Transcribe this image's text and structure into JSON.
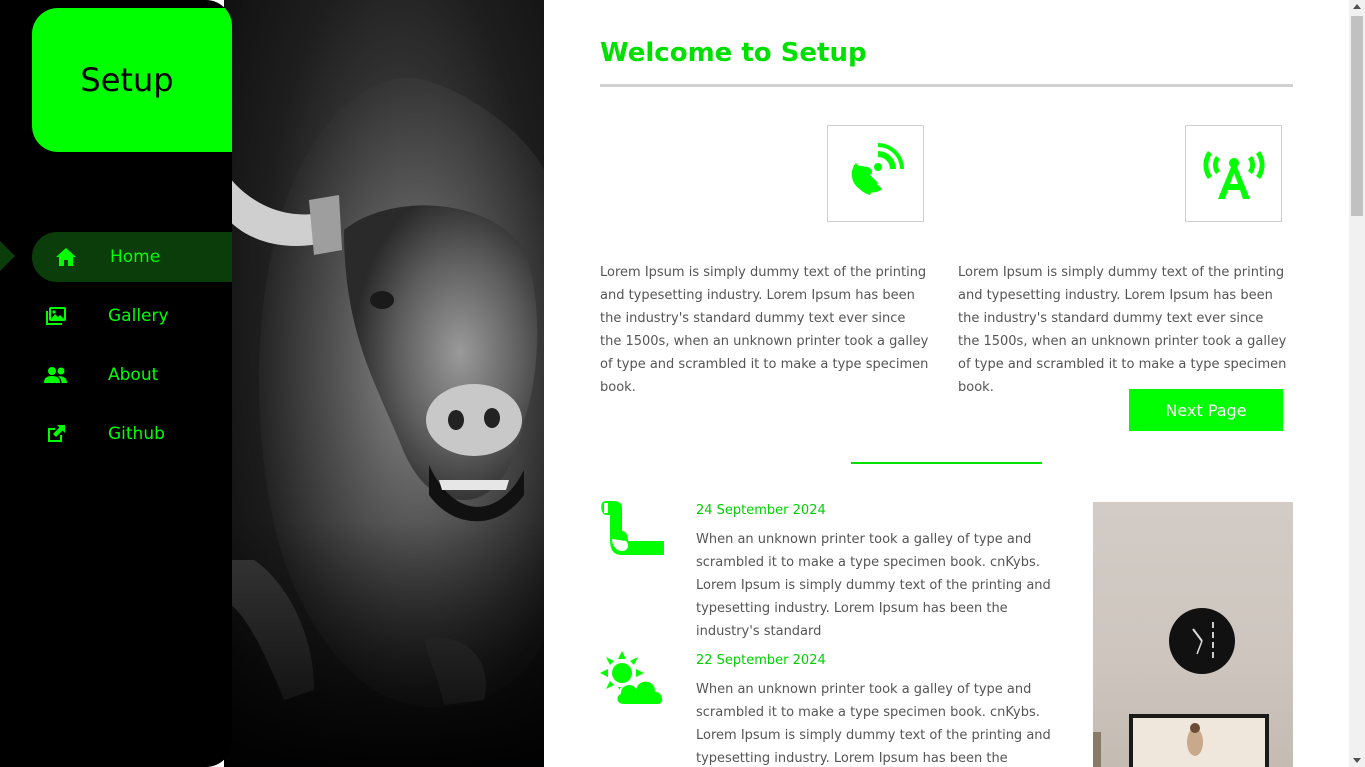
{
  "sidebar": {
    "brand": "Setup",
    "items": [
      {
        "label": "Home",
        "icon": "home-icon",
        "active": true
      },
      {
        "label": "Gallery",
        "icon": "gallery-icon",
        "active": false
      },
      {
        "label": "About",
        "icon": "users-icon",
        "active": false
      },
      {
        "label": "Github",
        "icon": "external-link-icon",
        "active": false
      }
    ]
  },
  "hero": {
    "icon": "bull-image"
  },
  "main": {
    "title": "Welcome to Setup",
    "features": [
      {
        "icon": "satellite-dish-icon",
        "text": "Lorem Ipsum is simply dummy text of the printing and typesetting industry. Lorem Ipsum has been the industry's standard dummy text ever since the 1500s, when an unknown printer took a galley of type and scrambled it to make a type specimen book."
      },
      {
        "icon": "broadcast-tower-icon",
        "text": "Lorem Ipsum is simply dummy text of the printing and typesetting industry. Lorem Ipsum has been the industry's standard dummy text ever since the 1500s, when an unknown printer took a galley of type and scrambled it to make a type specimen book."
      }
    ],
    "next_button": "Next Page",
    "posts": [
      {
        "icon": "scroll-icon",
        "date": "24 September 2024",
        "text": "When an unknown printer took a galley of type and scrambled it to make a type specimen book. cnKybs. Lorem Ipsum is simply dummy text of the printing and typesetting industry. Lorem Ipsum has been the industry's standard"
      },
      {
        "icon": "cloud-sun-icon",
        "date": "22 September 2024",
        "text": "When an unknown printer took a galley of type and scrambled it to make a type specimen book. cnKybs. Lorem Ipsum is simply dummy text of the printing and typesetting industry. Lorem Ipsum has been the industry's standard"
      }
    ],
    "photo": {
      "icon": "room-photo"
    }
  },
  "colors": {
    "accent": "#00ff00",
    "sidebar_bg": "#000000",
    "active_bg": "#0a3d0a",
    "text": "#555555"
  }
}
